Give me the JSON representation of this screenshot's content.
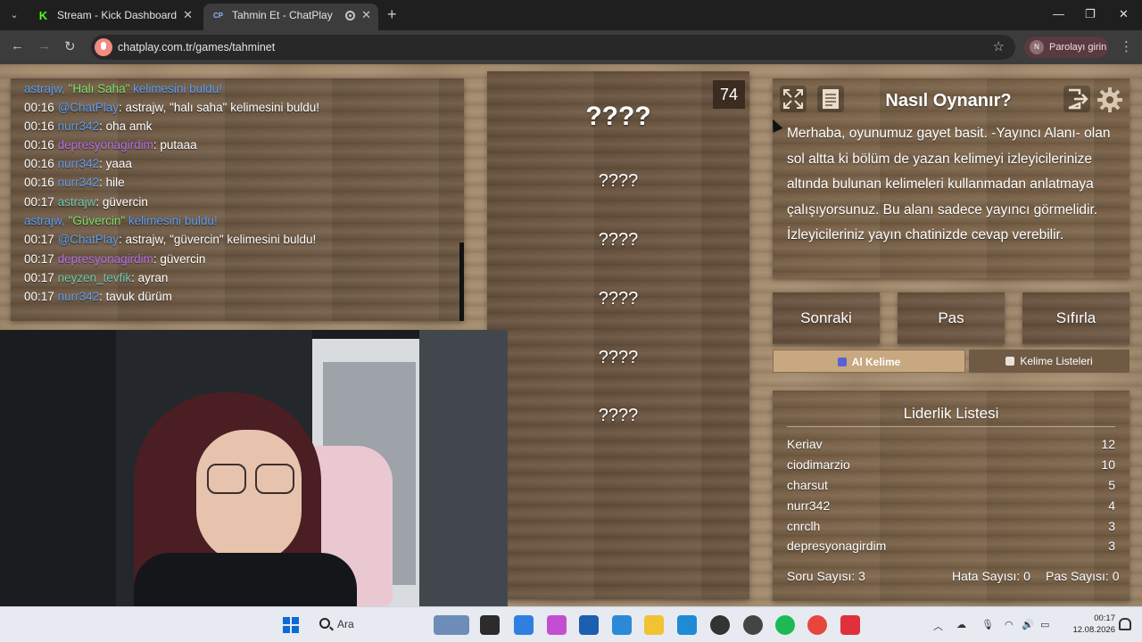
{
  "browser": {
    "tabs": [
      {
        "title": "Stream - Kick Dashboard",
        "favicon": "kick-logo"
      },
      {
        "title": "Tahmin Et - ChatPlay",
        "favicon": "CP"
      }
    ],
    "url": "chatplay.com.tr/games/tahminet",
    "profile_label": "Parolayı girin",
    "profile_initial": "N"
  },
  "chat": {
    "lines": [
      {
        "time": "",
        "user": "",
        "text": "astrajw, \"Halı Saha\" kelimesini buldu!",
        "kind": "system"
      },
      {
        "time": "00:16",
        "user": "@ChatPlay",
        "text": ": astrajw, \"halı saha\" kelimesini buldu!",
        "color": "blue"
      },
      {
        "time": "00:16",
        "user": "nurr342",
        "text": ": oha amk",
        "color": "blue"
      },
      {
        "time": "00:16",
        "user": "depresyonagirdim",
        "text": ": putaaa",
        "color": "purple"
      },
      {
        "time": "00:16",
        "user": "nurr342",
        "text": ": yaaa",
        "color": "blue"
      },
      {
        "time": "00:16",
        "user": "nurr342",
        "text": ": hile",
        "color": "blue"
      },
      {
        "time": "00:17",
        "user": "astrajw",
        "text": ": güvercin",
        "color": "teal"
      },
      {
        "time": "",
        "user": "",
        "text": "astrajw, \"Güvercin\" kelimesini buldu!",
        "kind": "system"
      },
      {
        "time": "00:17",
        "user": "@ChatPlay",
        "text": ": astrajw, \"güvercin\" kelimesini buldu!",
        "color": "blue"
      },
      {
        "time": "00:17",
        "user": "depresyonagirdim",
        "text": ": güvercin",
        "color": "purple"
      },
      {
        "time": "00:17",
        "user": "neyzen_tevfik",
        "text": ": ayran",
        "color": "teal"
      },
      {
        "time": "00:17",
        "user": "nurr342",
        "text": ": tavuk dürüm",
        "color": "blue"
      }
    ]
  },
  "game": {
    "counter": "74",
    "words": [
      "????",
      "????",
      "????",
      "????",
      "????",
      "????"
    ]
  },
  "how_to": {
    "title": "Nasıl Oynanır?",
    "text": "Merhaba, oyunumuz gayet basit. -Yayıncı Alanı- olan sol altta ki bölüm de yazan kelimeyi izleyicilerinize altında bulunan kelimeleri kullanmadan anlatmaya çalışıyorsunuz. Bu alanı sadece yayıncı görmelidir. İzleyicileriniz yayın chatinizde cevap verebilir."
  },
  "actions": {
    "next": "Sonraki",
    "pass": "Pas",
    "reset": "Sıfırla"
  },
  "tabs": {
    "get_word": "Al Kelime",
    "word_lists": "Kelime Listeleri"
  },
  "leaderboard": {
    "title": "Liderlik Listesi",
    "rows": [
      {
        "name": "Keriav",
        "score": "12"
      },
      {
        "name": "ciodimarzio",
        "score": "10"
      },
      {
        "name": "charsut",
        "score": "5"
      },
      {
        "name": "nurr342",
        "score": "4"
      },
      {
        "name": "cnrclh",
        "score": "3"
      },
      {
        "name": "depresyonagirdim",
        "score": "3"
      }
    ],
    "question_count": "Soru Sayısı: 3",
    "error_count": "Hata Sayısı: 0",
    "pass_count": "Pas Sayısı: 0"
  },
  "taskbar": {
    "search_label": "Ara",
    "time": "00:17",
    "date": "12.08.2026"
  },
  "colors": {
    "chat_user_blue": "#5c9ef2",
    "chat_user_purple": "#b670e8",
    "chat_user_teal": "#6fc7b0",
    "system_highlight": "#7ee06b",
    "wood": "#a38a6c",
    "active_tab": "#c7a881"
  }
}
